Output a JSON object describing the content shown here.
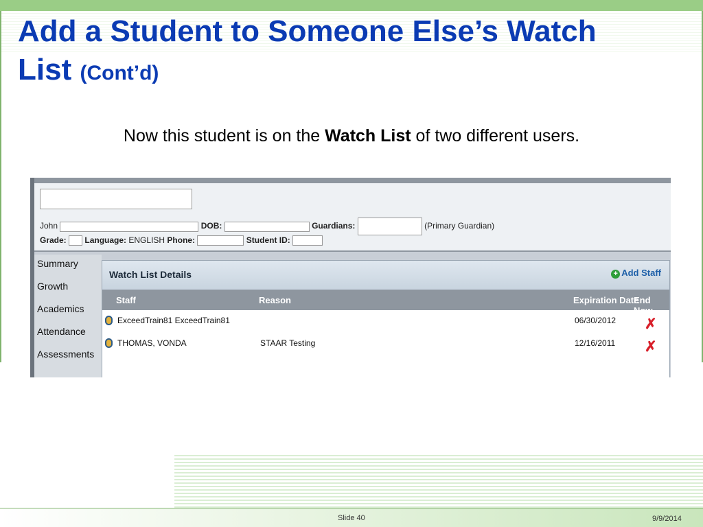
{
  "slide": {
    "title_main": "Add a Student to Someone Else’s Watch List",
    "title_suffix": "(Cont’d)",
    "subtitle_pre": "Now this student is on the ",
    "subtitle_bold": "Watch List",
    "subtitle_post": " of two different users.",
    "footer": {
      "slide_label": "Slide 40",
      "date": "9/9/2014"
    }
  },
  "student": {
    "name_prefix": "John",
    "dob_label": "DOB:",
    "guardians_label": "Guardians:",
    "guardian_note": "(Primary Guardian)",
    "grade_label": "Grade:",
    "language_label": "Language:",
    "language_value": "ENGLISH",
    "phone_label": "Phone:",
    "student_id_label": "Student ID:"
  },
  "nav": {
    "items": [
      "Summary",
      "Growth",
      "Academics",
      "Attendance",
      "Assessments"
    ]
  },
  "watch_list": {
    "title": "Watch List Details",
    "add_label": "Add Staff",
    "columns": {
      "staff": "Staff",
      "reason": "Reason",
      "expiration": "Expiration Date",
      "end": "End Now"
    },
    "rows": [
      {
        "staff": "ExceedTrain81 ExceedTrain81",
        "reason": "",
        "expiration": "06/30/2012"
      },
      {
        "staff": "THOMAS, VONDA",
        "reason": "STAAR Testing",
        "expiration": "12/16/2011"
      }
    ]
  },
  "colors": {
    "title": "#0b3bb3",
    "accent_green": "#9acd86",
    "end_now_x": "#d81f2a"
  },
  "icons": [
    "plus-icon",
    "pencil-icon",
    "x-icon"
  ]
}
